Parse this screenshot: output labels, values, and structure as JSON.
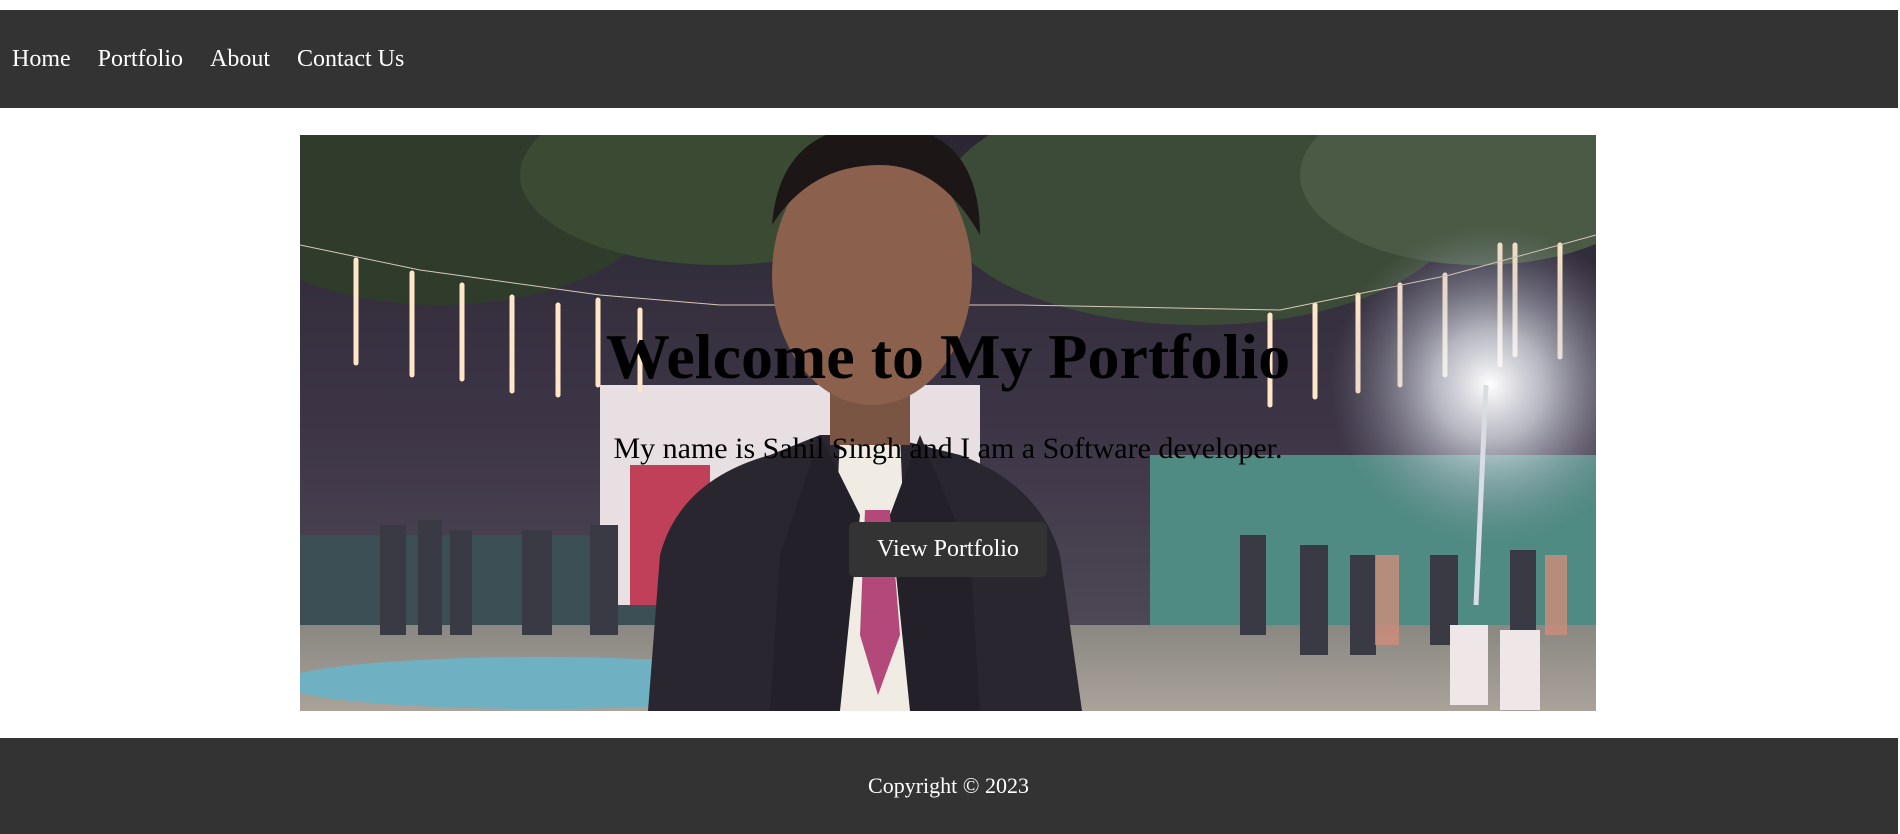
{
  "nav": {
    "items": [
      {
        "label": "Home"
      },
      {
        "label": "Portfolio"
      },
      {
        "label": "About"
      },
      {
        "label": "Contact Us"
      }
    ]
  },
  "hero": {
    "title": "Welcome to My Portfolio",
    "subtitle": "My name is Sahil Singh and I am a Software developer.",
    "button_label": "View Portfolio"
  },
  "footer": {
    "copyright": "Copyright © 2023"
  },
  "colors": {
    "bar_background": "#333333",
    "page_background": "#ffffff",
    "text_light": "#ffffff",
    "text_dark": "#000000"
  }
}
